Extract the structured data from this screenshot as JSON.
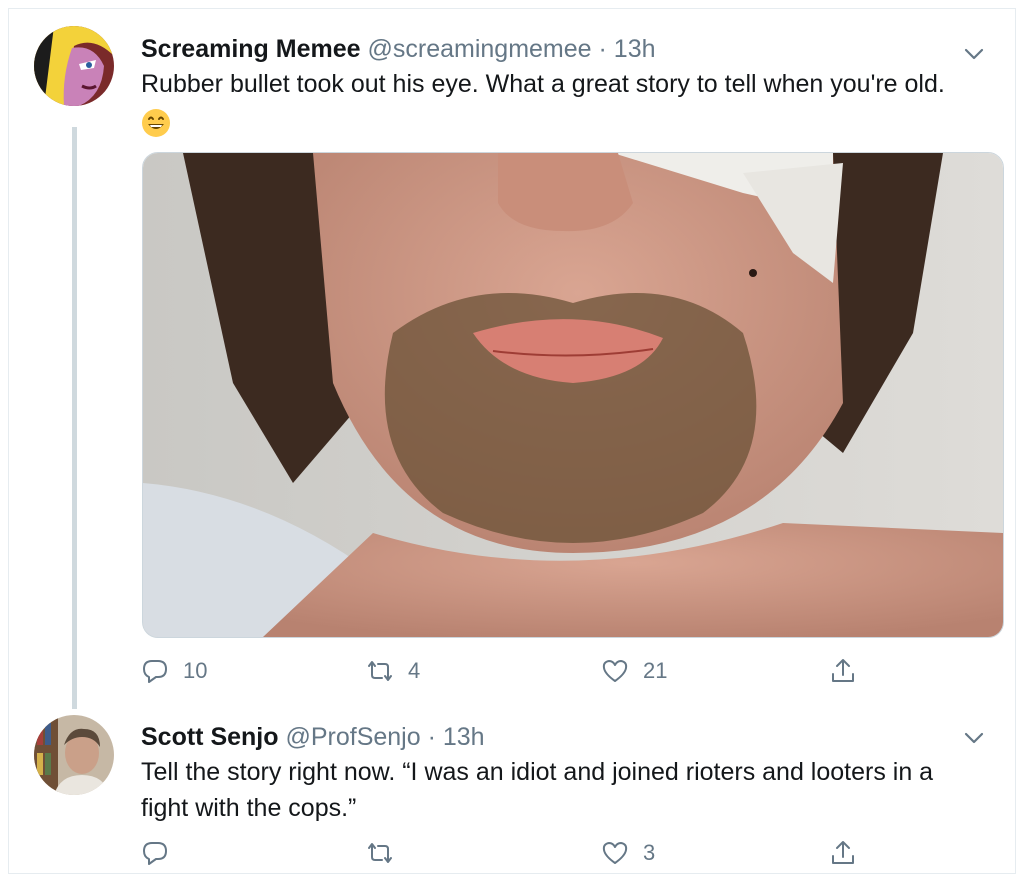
{
  "tweets": [
    {
      "name": "Screaming Memee",
      "handle": "@screamingmemee",
      "separator": "·",
      "time": "13h",
      "text": "Rubber bullet took out his eye. What a great story to tell when you're old.",
      "emoji": "grinning-face-emoji",
      "actions": {
        "reply": "10",
        "retweet": "4",
        "like": "21"
      }
    },
    {
      "name": "Scott Senjo",
      "handle": "@ProfSenjo",
      "separator": "·",
      "time": "13h",
      "text_line1": "Tell the story right now.  “I was an idiot and joined rioters and looters in a",
      "text_line2": "fight with the cops.”",
      "actions": {
        "reply": "",
        "retweet": "",
        "like": "3"
      }
    }
  ],
  "icons": {
    "reply": "reply-icon",
    "retweet": "retweet-icon",
    "like": "heart-icon",
    "share": "share-icon",
    "caret": "chevron-down-icon"
  },
  "colors": {
    "text": "#14171a",
    "secondary": "#657786",
    "border": "#e6ecf0",
    "thread_line": "#cfd9de"
  }
}
